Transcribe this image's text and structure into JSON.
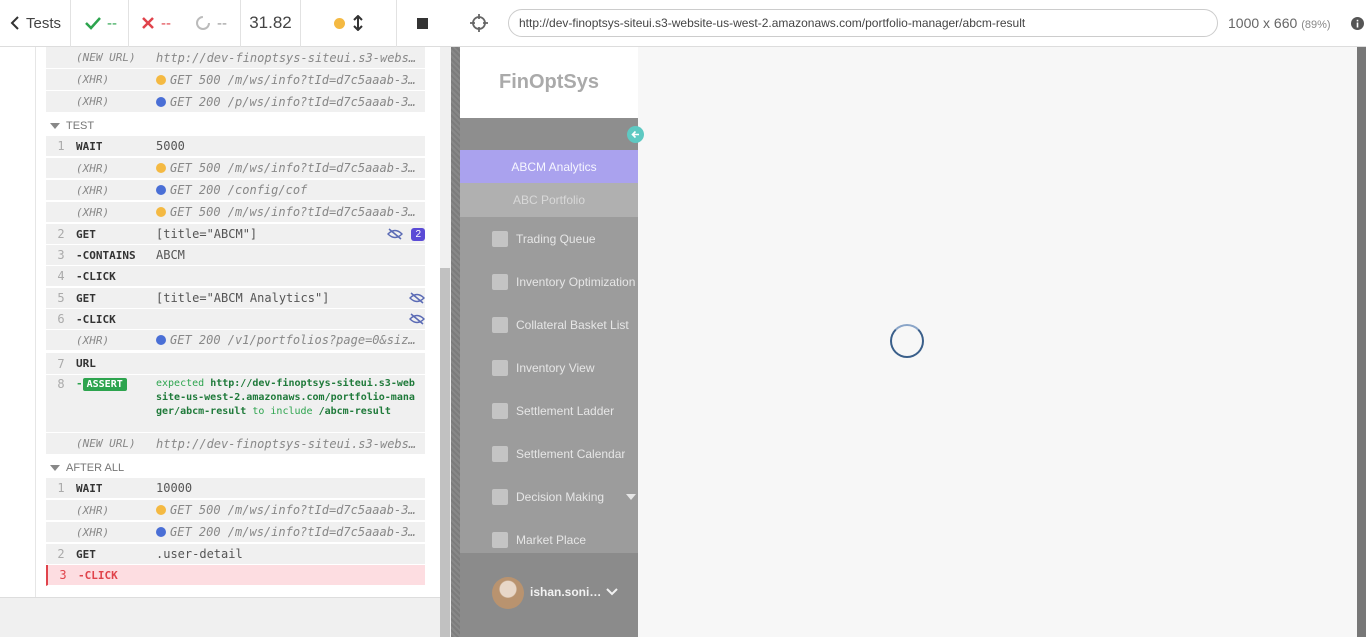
{
  "topbar": {
    "back_label": "Tests",
    "passed": "--",
    "failed": "--",
    "pending": "--",
    "duration": "31.82"
  },
  "reporter": {
    "rows_top": [
      {
        "cmd": "(NEW URL)",
        "msg": "http://dev-finoptsys-siteui.s3-webs…",
        "xhr": true
      },
      {
        "cmd": "(XHR)",
        "msg": "GET 500 /m/ws/info?tId=d7c5aaab-3…",
        "xhr": true,
        "dot": "y"
      },
      {
        "cmd": "(XHR)",
        "msg": "GET 200 /p/ws/info?tId=d7c5aaab-3…",
        "xhr": true,
        "dot": "b"
      }
    ],
    "test_section": "TEST",
    "test_rows": [
      {
        "num": "1",
        "cmd": "WAIT",
        "msg": "5000"
      },
      {
        "cmd": "(XHR)",
        "msg": "GET 500 /m/ws/info?tId=d7c5aaab-3…",
        "xhr": true,
        "dot": "y"
      },
      {
        "cmd": "(XHR)",
        "msg": "GET 200 /config/cof",
        "xhr": true,
        "dot": "b"
      },
      {
        "cmd": "(XHR)",
        "msg": "GET 500 /m/ws/info?tId=d7c5aaab-3…",
        "xhr": true,
        "dot": "y"
      },
      {
        "num": "2",
        "cmd": "GET",
        "msg": "[title=\"ABCM\"]",
        "badge": "2"
      },
      {
        "num": "3",
        "cmd": "-CONTAINS",
        "msg": "ABCM"
      },
      {
        "num": "4",
        "cmd": "-CLICK",
        "msg": ""
      },
      {
        "num": "5",
        "cmd": "GET",
        "msg": "[title=\"ABCM Analytics\"]"
      },
      {
        "num": "6",
        "cmd": "-CLICK",
        "msg": ""
      },
      {
        "cmd": "(XHR)",
        "msg": "GET 200 /v1/portfolios?page=0&siz…",
        "xhr": true,
        "dot": "b"
      },
      {
        "num": "7",
        "cmd": "URL",
        "msg": ""
      }
    ],
    "assert": {
      "num": "8",
      "tag": "ASSERT",
      "expected_word": "expected",
      "expected_value": "http://dev-finoptsys-siteui.s3-website-us-west-2.amazonaws.com/portfolio-manager/abcm-result",
      "to_include": "to include",
      "include_value": "/abcm-result"
    },
    "new_url_row": {
      "cmd": "(NEW URL)",
      "msg": "http://dev-finoptsys-siteui.s3-webs…"
    },
    "after_section": "AFTER ALL",
    "after_rows": [
      {
        "num": "1",
        "cmd": "WAIT",
        "msg": "10000"
      },
      {
        "cmd": "(XHR)",
        "msg": "GET 500 /m/ws/info?tId=d7c5aaab-3…",
        "xhr": true,
        "dot": "y"
      },
      {
        "cmd": "(XHR)",
        "msg": "GET 200 /m/ws/info?tId=d7c5aaab-3…",
        "xhr": true,
        "dot": "b"
      },
      {
        "num": "2",
        "cmd": "GET",
        "msg": ".user-detail"
      },
      {
        "num": "3",
        "cmd": "-CLICK",
        "msg": "",
        "failed": true
      }
    ]
  },
  "browser": {
    "url": "http://dev-finoptsys-siteui.s3-website-us-west-2.amazonaws.com/portfolio-manager/abcm-result",
    "viewport": "1000 x 660",
    "zoom": "(89%)"
  },
  "app": {
    "brace": "}",
    "logo": "FinOptSys",
    "nav_active": "ABCM Analytics",
    "nav_sub": "ABC Portfolio",
    "nav_items": [
      "Trading Queue",
      "Inventory Optimization",
      "Collateral Basket List",
      "Inventory View",
      "Settlement Ladder",
      "Settlement Calendar",
      "Decision Making",
      "Market Place"
    ],
    "user": "ishan.soni…"
  },
  "colors": {
    "accent_active": "#a9a0f0",
    "pending_dot": "#f4b942",
    "success_dot": "#4a6fd6",
    "fail_row": "#fddde1"
  }
}
